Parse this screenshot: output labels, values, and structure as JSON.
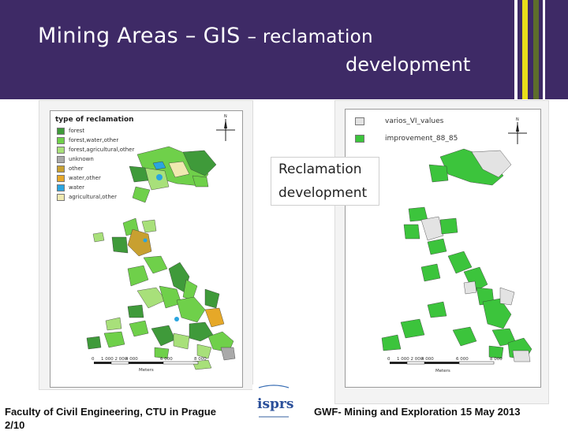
{
  "slide": {
    "title_line1": "Mining Areas – GIS",
    "title_line2_part": "– reclamation",
    "title_line3": "development",
    "colors": {
      "header_bg": "#3e2a66",
      "stripe_yellow": "#e8dd1a",
      "stripe_green": "#5e6e2c"
    }
  },
  "map_left": {
    "legend_title": "type of reclamation",
    "legend": [
      {
        "label": "forest",
        "color": "#3f9a3a"
      },
      {
        "label": "forest,water,other",
        "color": "#6fd04a"
      },
      {
        "label": "forest,agricultural,other",
        "color": "#a8e07a"
      },
      {
        "label": "unknown",
        "color": "#a9a9a9"
      },
      {
        "label": "other",
        "color": "#c8a030"
      },
      {
        "label": "water,other",
        "color": "#e6a828"
      },
      {
        "label": "water",
        "color": "#2aa5e0"
      },
      {
        "label": "agricultural,other",
        "color": "#efe9b0"
      }
    ],
    "scale_ticks": [
      "0",
      "1 000 2 000",
      "4 000",
      "6 000",
      "8 000"
    ],
    "scale_unit": "Meters",
    "north_icon": "north-arrow-icon"
  },
  "map_right": {
    "legend": [
      {
        "label": "varios_VI_values",
        "color": "#e3e3e3"
      },
      {
        "label": "improvement_88_85",
        "color": "#3cc43c"
      }
    ],
    "scale_ticks": [
      "0",
      "1 000 2 000",
      "4 000",
      "6 000",
      "8 000"
    ],
    "scale_unit": "Meters",
    "north_icon": "north-arrow-icon"
  },
  "callout": {
    "line1": "Reclamation",
    "line2": "development"
  },
  "footer": {
    "left": "Faculty of Civil Engineering, CTU in Prague",
    "left_cut": "2/10",
    "right": "GWF- Mining and Exploration 15 May 2013",
    "logo_text": "isprs"
  }
}
